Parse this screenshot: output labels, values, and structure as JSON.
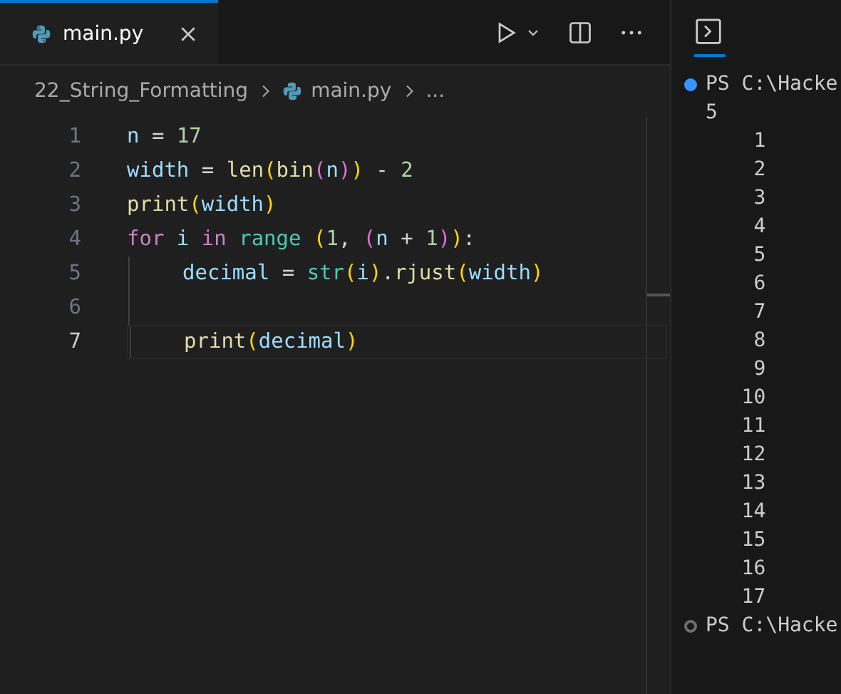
{
  "tab": {
    "label": "main.py",
    "selected": true
  },
  "breadcrumbs": [
    {
      "label": "22_String_Formatting",
      "kind": "folder"
    },
    {
      "label": "main.py",
      "kind": "file"
    },
    {
      "label": "...",
      "kind": "more"
    }
  ],
  "code_lines": [
    {
      "number": "1",
      "current": false,
      "indent": false,
      "tokens": [
        {
          "text": "n",
          "kind": "var"
        },
        {
          "text": " = ",
          "kind": "op"
        },
        {
          "text": "17",
          "kind": "num"
        }
      ]
    },
    {
      "number": "2",
      "current": false,
      "indent": false,
      "tokens": [
        {
          "text": "width",
          "kind": "var"
        },
        {
          "text": " = ",
          "kind": "op"
        },
        {
          "text": "len",
          "kind": "func"
        },
        {
          "text": "(",
          "kind": "paren1"
        },
        {
          "text": "bin",
          "kind": "func"
        },
        {
          "text": "(",
          "kind": "paren2"
        },
        {
          "text": "n",
          "kind": "var"
        },
        {
          "text": ")",
          "kind": "paren2"
        },
        {
          "text": ")",
          "kind": "paren1"
        },
        {
          "text": " - ",
          "kind": "op"
        },
        {
          "text": "2",
          "kind": "num"
        }
      ]
    },
    {
      "number": "3",
      "current": false,
      "indent": false,
      "tokens": [
        {
          "text": "print",
          "kind": "func"
        },
        {
          "text": "(",
          "kind": "paren1"
        },
        {
          "text": "width",
          "kind": "var"
        },
        {
          "text": ")",
          "kind": "paren1"
        }
      ]
    },
    {
      "number": "4",
      "current": false,
      "indent": false,
      "tokens": [
        {
          "text": "for ",
          "kind": "kw"
        },
        {
          "text": "i ",
          "kind": "var"
        },
        {
          "text": "in ",
          "kind": "kw"
        },
        {
          "text": "range ",
          "kind": "class"
        },
        {
          "text": "(",
          "kind": "paren1"
        },
        {
          "text": "1",
          "kind": "num"
        },
        {
          "text": ", ",
          "kind": "op"
        },
        {
          "text": "(",
          "kind": "paren2"
        },
        {
          "text": "n",
          "kind": "var"
        },
        {
          "text": " + ",
          "kind": "op"
        },
        {
          "text": "1",
          "kind": "num"
        },
        {
          "text": ")",
          "kind": "paren2"
        },
        {
          "text": ")",
          "kind": "paren1"
        },
        {
          "text": ":",
          "kind": "op"
        }
      ]
    },
    {
      "number": "5",
      "current": false,
      "indent": true,
      "tokens": [
        {
          "text": "decimal",
          "kind": "var"
        },
        {
          "text": " = ",
          "kind": "op"
        },
        {
          "text": "str",
          "kind": "class"
        },
        {
          "text": "(",
          "kind": "paren1"
        },
        {
          "text": "i",
          "kind": "var"
        },
        {
          "text": ")",
          "kind": "paren1"
        },
        {
          "text": ".",
          "kind": "op"
        },
        {
          "text": "rjust",
          "kind": "func"
        },
        {
          "text": "(",
          "kind": "paren1"
        },
        {
          "text": "width",
          "kind": "var"
        },
        {
          "text": ")",
          "kind": "paren1"
        }
      ]
    },
    {
      "number": "6",
      "current": false,
      "indent": true
    },
    {
      "number": "7",
      "current": true,
      "indent": true,
      "tokens": [
        {
          "text": "print",
          "kind": "func"
        },
        {
          "text": "(",
          "kind": "paren1"
        },
        {
          "text": "decimal",
          "kind": "var"
        },
        {
          "text": ")",
          "kind": "paren1"
        }
      ]
    }
  ],
  "terminal_lines": [
    {
      "kind": "prompt",
      "text": "PS C:\\Hacke",
      "color": "#3794ff"
    },
    {
      "kind": "output",
      "text": "5"
    },
    {
      "kind": "output",
      "text": "    1"
    },
    {
      "kind": "output",
      "text": "    2"
    },
    {
      "kind": "output",
      "text": "    3"
    },
    {
      "kind": "output",
      "text": "    4"
    },
    {
      "kind": "output",
      "text": "    5"
    },
    {
      "kind": "output",
      "text": "    6"
    },
    {
      "kind": "output",
      "text": "    7"
    },
    {
      "kind": "output",
      "text": "    8"
    },
    {
      "kind": "output",
      "text": "    9"
    },
    {
      "kind": "output",
      "text": "   10"
    },
    {
      "kind": "output",
      "text": "   11"
    },
    {
      "kind": "output",
      "text": "   12"
    },
    {
      "kind": "output",
      "text": "   13"
    },
    {
      "kind": "output",
      "text": "   14"
    },
    {
      "kind": "output",
      "text": "   15"
    },
    {
      "kind": "output",
      "text": "   16"
    },
    {
      "kind": "output",
      "text": "   17"
    },
    {
      "kind": "prompt",
      "text": "PS C:\\Hacke",
      "color": "#6e6e6e"
    }
  ]
}
